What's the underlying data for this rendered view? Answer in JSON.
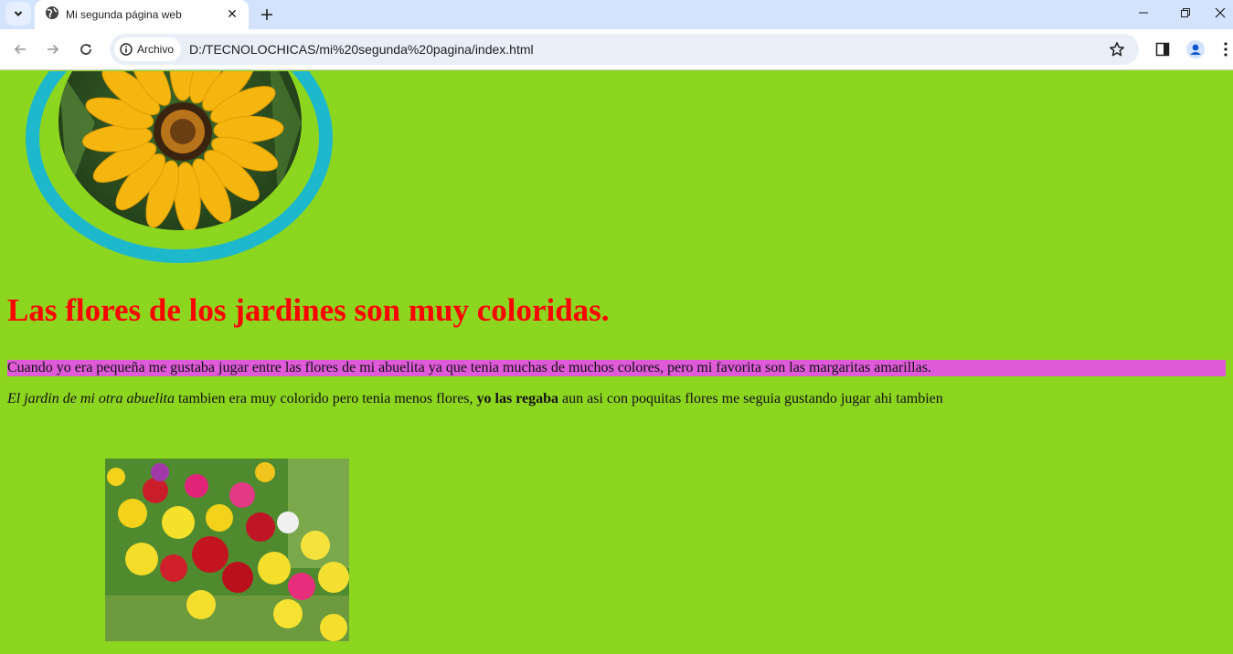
{
  "browser": {
    "tab_title": "Mi segunda página web",
    "address_chip_label": "Archivo",
    "url": "D:/TECNOLOCHICAS/mi%20segunda%20pagina/index.html"
  },
  "page": {
    "heading": "Las flores de los jardines son muy coloridas.",
    "paragraph1": "Cuando yo era pequeña me gustaba jugar entre las flores de mi abuelita ya que tenia muchas de muchos colores, pero mi favorita son las margaritas amarillas.",
    "paragraph2": {
      "italic": "El jardin de mi otra abuelita",
      "text1": " tambien era muy colorido pero tenia menos flores, ",
      "bold": "yo las regaba",
      "text2": " aun asi con poquitas flores me seguia gustando jugar ahi tambien"
    },
    "images": {
      "top": "yellow-flower-photo",
      "bottom": "flower-garden-photo"
    }
  },
  "colors": {
    "page_background": "#8dd61f",
    "heading": "#ff0000",
    "paragraph1_background": "#de5ad8",
    "oval_border": "#1eb8cc",
    "tabbar": "#d3e3fd"
  }
}
